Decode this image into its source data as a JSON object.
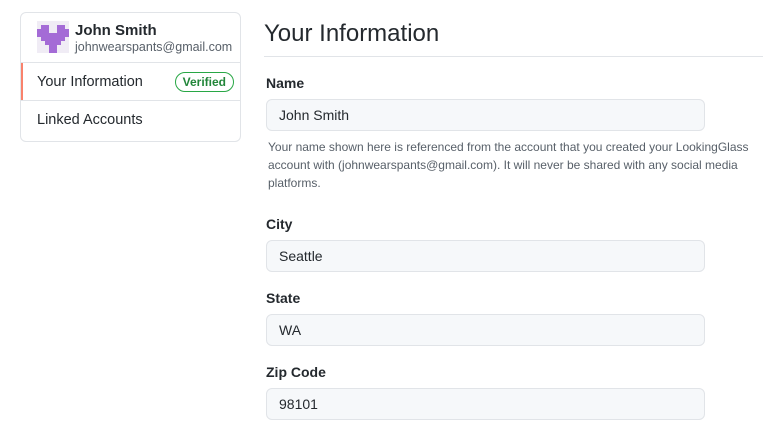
{
  "profile": {
    "name": "John Smith",
    "email": "johnwearspants@gmail.com",
    "avatar_icon": "pixel-avatar-icon",
    "avatar_color": "#a46bd6"
  },
  "sidebar": {
    "items": [
      {
        "label": "Your Information",
        "badge": "Verified",
        "selected": true
      },
      {
        "label": "Linked Accounts"
      }
    ],
    "badge_color": "#28a745",
    "selected_accent": "#f9826c"
  },
  "main": {
    "title": "Your Information",
    "fields": [
      {
        "label": "Name",
        "value": "John Smith",
        "note": "Your name shown here is referenced from the account that you created your LookingGlass account with (johnwearspants@gmail.com). It will never be shared with any social media platforms."
      },
      {
        "label": "City",
        "value": "Seattle"
      },
      {
        "label": "State",
        "value": "WA"
      },
      {
        "label": "Zip Code",
        "value": "98101"
      }
    ]
  }
}
